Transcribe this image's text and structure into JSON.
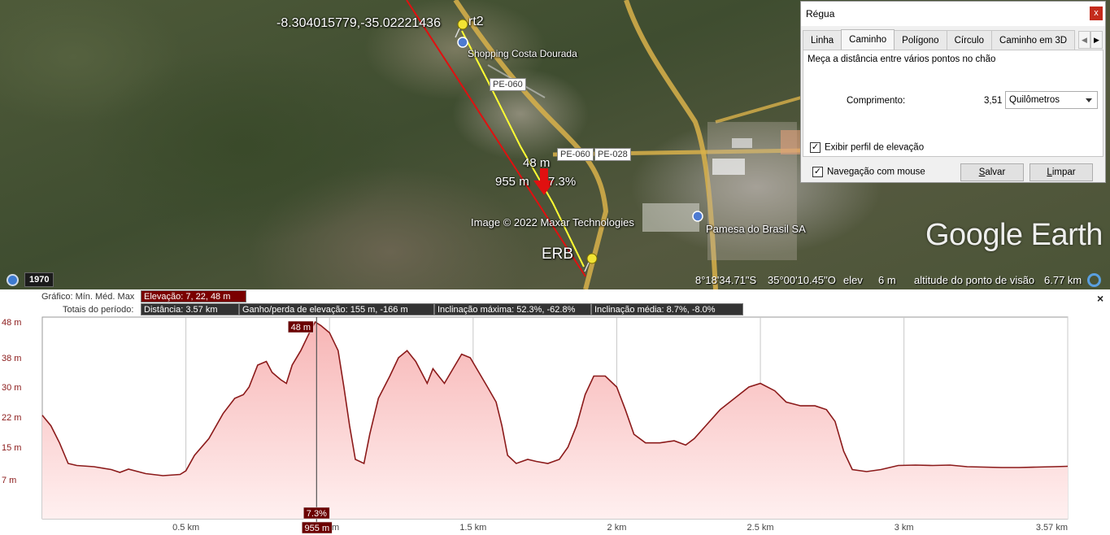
{
  "map": {
    "coord_label": "-8.304015779,-35.02221436",
    "pin_top_label": "rt2",
    "pin_bottom_label": "ERB",
    "poi_shopping": "Shopping Costa Dourada",
    "poi_pamesa": "Pamesa do Brasil SA",
    "road_labels": [
      "PE-060",
      "PE-060",
      "PE-028"
    ],
    "cursor_elevation": "48 m",
    "cursor_distance": "955 m",
    "cursor_slope": "7.3%",
    "copyright": "Image © 2022 Maxar Technologies",
    "logo_text": "Google Earth",
    "year": "1970",
    "status": {
      "lat": "8°18'34.71\"S",
      "lon": "35°00'10.45\"O",
      "elev_label": "elev",
      "elev_value": "6 m",
      "viewpoint_label": "altitude do ponto de visão",
      "viewpoint_value": "6.77 km"
    },
    "colors": {
      "path_yellow": "#ffff33",
      "line_red": "#e01010"
    }
  },
  "ruler": {
    "title": "Régua",
    "close": "x",
    "tabs": [
      "Linha",
      "Caminho",
      "Polígono",
      "Círculo",
      "Caminho em 3D"
    ],
    "active_tab": "Caminho",
    "description": "Meça a distância entre vários pontos no chão",
    "length_label": "Comprimento:",
    "length_value": "3,51",
    "units": "Quilômetros",
    "show_elevation_profile": "Exibir perfil de elevação",
    "mouse_navigation": "Navegação com mouse",
    "save_prefix": "",
    "save_underlined": "S",
    "save_rest": "alvar",
    "clear_prefix": "",
    "clear_underlined": "L",
    "clear_rest": "impar"
  },
  "profile": {
    "graph_label": "Gráfico: Mín. Méd. Max",
    "elevation_summary": "Elevação: 7, 22, 48 m",
    "totals_label": "Totais do período:",
    "distance": "Distância: 3.57 km",
    "gain_loss": "Ganho/perda de elevação: 155 m, -166 m",
    "max_slope": "Inclinação máxima: 52.3%, -62.8%",
    "avg_slope": "Inclinação média: 8.7%, -8.0%",
    "close": "×",
    "cursor_elev_tag": "48 m",
    "cursor_slope_tag": "7.3%",
    "cursor_dist_tag": "955 m"
  },
  "chart_data": {
    "type": "area",
    "xlabel": "",
    "ylabel": "",
    "ylim": [
      0,
      48
    ],
    "xlim": [
      0,
      3.57
    ],
    "y_ticks": [
      {
        "label": "48 m",
        "value": 48
      },
      {
        "label": "38 m",
        "value": 38
      },
      {
        "label": "30 m",
        "value": 30
      },
      {
        "label": "22 m",
        "value": 22
      },
      {
        "label": "15 m",
        "value": 15
      },
      {
        "label": "7 m",
        "value": 7
      }
    ],
    "x_ticks": [
      {
        "label": "0.5 km",
        "value": 0.5
      },
      {
        "label": "1 km",
        "value": 1.0
      },
      {
        "label": "1.5 km",
        "value": 1.5
      },
      {
        "label": "2 km",
        "value": 2.0
      },
      {
        "label": "2.5 km",
        "value": 2.5
      },
      {
        "label": "3 km",
        "value": 3.0
      },
      {
        "label": "3.57 km",
        "value": 3.57
      }
    ],
    "cursor_x": 0.955,
    "series": [
      {
        "points": [
          [
            0.0,
            22.5
          ],
          [
            0.03,
            20
          ],
          [
            0.06,
            16
          ],
          [
            0.09,
            11
          ],
          [
            0.12,
            10.5
          ],
          [
            0.18,
            10.2
          ],
          [
            0.24,
            9.5
          ],
          [
            0.27,
            8.8
          ],
          [
            0.3,
            9.6
          ],
          [
            0.36,
            8.5
          ],
          [
            0.42,
            8
          ],
          [
            0.48,
            8.3
          ],
          [
            0.5,
            9.2
          ],
          [
            0.53,
            13
          ],
          [
            0.58,
            17
          ],
          [
            0.63,
            23
          ],
          [
            0.67,
            27
          ],
          [
            0.7,
            28
          ],
          [
            0.72,
            30
          ],
          [
            0.75,
            36
          ],
          [
            0.78,
            37
          ],
          [
            0.8,
            34
          ],
          [
            0.83,
            32
          ],
          [
            0.85,
            31
          ],
          [
            0.87,
            36
          ],
          [
            0.9,
            40
          ],
          [
            0.93,
            45
          ],
          [
            0.95,
            48
          ],
          [
            0.97,
            47
          ],
          [
            1.0,
            45
          ],
          [
            1.03,
            40
          ],
          [
            1.05,
            30
          ],
          [
            1.07,
            20
          ],
          [
            1.09,
            12
          ],
          [
            1.12,
            11
          ],
          [
            1.14,
            18
          ],
          [
            1.17,
            27
          ],
          [
            1.21,
            33
          ],
          [
            1.24,
            38
          ],
          [
            1.27,
            40
          ],
          [
            1.3,
            37
          ],
          [
            1.32,
            34
          ],
          [
            1.34,
            31
          ],
          [
            1.36,
            35
          ],
          [
            1.38,
            33
          ],
          [
            1.4,
            31
          ],
          [
            1.43,
            35
          ],
          [
            1.46,
            39
          ],
          [
            1.49,
            38
          ],
          [
            1.52,
            34
          ],
          [
            1.55,
            30
          ],
          [
            1.58,
            26
          ],
          [
            1.6,
            20
          ],
          [
            1.62,
            13
          ],
          [
            1.65,
            11
          ],
          [
            1.69,
            12
          ],
          [
            1.72,
            11.5
          ],
          [
            1.76,
            11
          ],
          [
            1.8,
            12
          ],
          [
            1.83,
            15
          ],
          [
            1.86,
            20
          ],
          [
            1.89,
            28
          ],
          [
            1.92,
            33
          ],
          [
            1.96,
            33
          ],
          [
            2.0,
            30
          ],
          [
            2.03,
            24
          ],
          [
            2.06,
            18
          ],
          [
            2.1,
            16
          ],
          [
            2.15,
            16
          ],
          [
            2.2,
            16.5
          ],
          [
            2.24,
            15.5
          ],
          [
            2.27,
            17
          ],
          [
            2.31,
            20
          ],
          [
            2.36,
            24
          ],
          [
            2.41,
            27
          ],
          [
            2.46,
            30
          ],
          [
            2.5,
            31
          ],
          [
            2.55,
            29
          ],
          [
            2.59,
            26
          ],
          [
            2.64,
            25
          ],
          [
            2.69,
            25
          ],
          [
            2.73,
            24
          ],
          [
            2.76,
            21
          ],
          [
            2.79,
            14
          ],
          [
            2.82,
            9.5
          ],
          [
            2.87,
            9
          ],
          [
            2.92,
            9.5
          ],
          [
            2.98,
            10.5
          ],
          [
            3.04,
            10.6
          ],
          [
            3.1,
            10.5
          ],
          [
            3.16,
            10.6
          ],
          [
            3.22,
            10.2
          ],
          [
            3.28,
            10.1
          ],
          [
            3.34,
            10
          ],
          [
            3.4,
            10
          ],
          [
            3.46,
            10.1
          ],
          [
            3.52,
            10.2
          ],
          [
            3.57,
            10.3
          ]
        ]
      }
    ],
    "colors": {
      "line": "#8b1a1a",
      "fill_top": "#f7b5b5",
      "fill_bottom": "#fff0f0"
    }
  }
}
